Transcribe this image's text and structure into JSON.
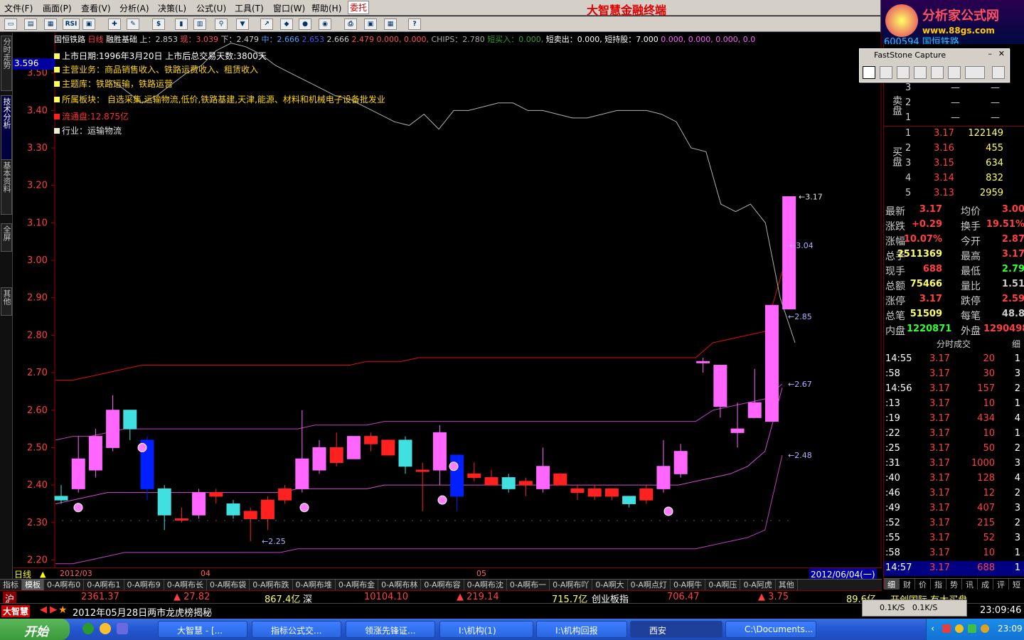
{
  "menu": {
    "items": [
      "文件(F)",
      "画面(P)",
      "查看(V)",
      "分析(A)",
      "决策(L)",
      "公式(U)",
      "工具(T)",
      "窗口(W)",
      "帮助(H)"
    ],
    "hot": "委托",
    "app_title": "大智慧金融终端"
  },
  "brand": {
    "name": "分析家公式网",
    "url": "www.88gs.com"
  },
  "toolbar": {
    "rsi": "RSI"
  },
  "leftnav": {
    "tabs": [
      "分时走势",
      "技术分析",
      "基本资料",
      "全屏",
      "其他"
    ]
  },
  "chart": {
    "name": "国恒铁路",
    "period": "日线",
    "indicator": "融胜基础",
    "info_fields": [
      "上：2.853",
      "现：3.039",
      "下：2.479",
      "中：2.666",
      "2.653",
      "2.666",
      "2.479",
      "0.000, 0.000,",
      "CHIPS：2.780",
      "短买入：0.000,",
      "短卖出：0.000,",
      "短持股：7.000",
      "0.000, 0.000, 0.000, 0.0"
    ],
    "current_price": "3.596",
    "overlay": [
      {
        "text": "上市日期:1996年3月20日  上市后总交易天数:3800天",
        "color": "#ffffff",
        "sq": "#ffff60"
      },
      {
        "text": "主营业务：商品销售收入、铁路运费收入、租赁收入",
        "color": "#ffd700",
        "sq": "#ffff60"
      },
      {
        "text": "主题库：铁路运输，铁路运营",
        "color": "#ffd700",
        "sq": "#ffff60"
      },
      {
        "text": "所属板块： 自选采集,运输物流,低价,铁路基建,天津,能源、材料和机械电子设备批发业",
        "color": "#ffd700",
        "sq": "#ffff60"
      },
      {
        "text": "流通盘:12.875亿",
        "color": "#ff3030",
        "sq": "#ff2020"
      },
      {
        "text": "行业：运输物流",
        "color": "#e0e0e0",
        "sq": "#f0f0d0"
      }
    ],
    "yticks": [
      "3.50",
      "3.40",
      "3.30",
      "3.20",
      "3.10",
      "3.00",
      "2.90",
      "2.80",
      "2.70",
      "2.60",
      "2.50",
      "2.40",
      "2.30",
      "2.20"
    ],
    "annotations": [
      "3.17",
      "3.04",
      "2.85",
      "2.67",
      "2.48",
      "2.25"
    ],
    "dates": [
      "2012/03",
      "04",
      "05"
    ],
    "date_right": "2012/06/04(一)",
    "period_label": "日线"
  },
  "chart_data": {
    "type": "candlestick",
    "ylim": [
      2.18,
      3.6
    ],
    "candles": [
      [
        2.37,
        2.36,
        2.4,
        2.35
      ],
      [
        2.39,
        2.47,
        2.53,
        2.38
      ],
      [
        2.44,
        2.53,
        2.55,
        2.42
      ],
      [
        2.5,
        2.6,
        2.64,
        2.49
      ],
      [
        2.6,
        2.55,
        2.6,
        2.52
      ],
      [
        2.52,
        2.39,
        2.53,
        2.36
      ],
      [
        2.39,
        2.32,
        2.4,
        2.28
      ],
      [
        2.31,
        2.31,
        2.34,
        2.3
      ],
      [
        2.32,
        2.38,
        2.39,
        2.31
      ],
      [
        2.37,
        2.38,
        2.39,
        2.35
      ],
      [
        2.35,
        2.32,
        2.36,
        2.31
      ],
      [
        2.31,
        2.33,
        2.34,
        2.25
      ],
      [
        2.31,
        2.36,
        2.37,
        2.28
      ],
      [
        2.36,
        2.39,
        2.4,
        2.35
      ],
      [
        2.39,
        2.47,
        2.6,
        2.38
      ],
      [
        2.44,
        2.5,
        2.52,
        2.43
      ],
      [
        2.46,
        2.5,
        2.54,
        2.45
      ],
      [
        2.47,
        2.53,
        2.53,
        2.47
      ],
      [
        2.51,
        2.53,
        2.54,
        2.49
      ],
      [
        2.48,
        2.52,
        2.52,
        2.48
      ],
      [
        2.52,
        2.45,
        2.53,
        2.43
      ],
      [
        2.44,
        2.44,
        2.46,
        2.33
      ],
      [
        2.44,
        2.54,
        2.56,
        2.4
      ],
      [
        2.48,
        2.37,
        2.48,
        2.33
      ],
      [
        2.42,
        2.43,
        2.46,
        2.41
      ],
      [
        2.4,
        2.42,
        2.44,
        2.4
      ],
      [
        2.42,
        2.39,
        2.43,
        2.38
      ],
      [
        2.4,
        2.41,
        2.42,
        2.37
      ],
      [
        2.39,
        2.45,
        2.5,
        2.38
      ],
      [
        2.4,
        2.43,
        2.43,
        2.4
      ],
      [
        2.38,
        2.39,
        2.4,
        2.36
      ],
      [
        2.37,
        2.39,
        2.4,
        2.36
      ],
      [
        2.37,
        2.39,
        2.39,
        2.36
      ],
      [
        2.37,
        2.35,
        2.37,
        2.34
      ],
      [
        2.36,
        2.39,
        2.4,
        2.35
      ],
      [
        2.39,
        2.45,
        2.52,
        2.38
      ],
      [
        2.43,
        2.49,
        2.51,
        2.42
      ],
      [
        2.73,
        2.73,
        2.74,
        2.7
      ],
      [
        2.61,
        2.72,
        2.72,
        2.58
      ],
      [
        2.54,
        2.55,
        2.62,
        2.5
      ],
      [
        2.58,
        2.62,
        2.71,
        2.58
      ],
      [
        2.57,
        2.88,
        2.88,
        2.57
      ],
      [
        2.87,
        3.17,
        3.17,
        2.87
      ]
    ],
    "upper": [
      2.68,
      2.68,
      2.69,
      2.7,
      2.71,
      2.72,
      2.72,
      2.72,
      2.72,
      2.72,
      2.72,
      2.72,
      2.72,
      2.72,
      2.72,
      2.72,
      2.72,
      2.72,
      2.73,
      2.73,
      2.73,
      2.74,
      2.74,
      2.74,
      2.74,
      2.74,
      2.74,
      2.74,
      2.74,
      2.74,
      2.74,
      2.74,
      2.74,
      2.74,
      2.74,
      2.74,
      2.74,
      2.74,
      2.78,
      2.79,
      2.8,
      2.81,
      2.97
    ],
    "mid": [
      2.52,
      2.53,
      2.53,
      2.54,
      2.55,
      2.55,
      2.55,
      2.55,
      2.55,
      2.55,
      2.55,
      2.55,
      2.55,
      2.55,
      2.55,
      2.56,
      2.56,
      2.56,
      2.56,
      2.57,
      2.57,
      2.57,
      2.57,
      2.57,
      2.57,
      2.57,
      2.57,
      2.57,
      2.57,
      2.57,
      2.57,
      2.57,
      2.57,
      2.57,
      2.57,
      2.57,
      2.57,
      2.57,
      2.6,
      2.61,
      2.62,
      2.63,
      2.67
    ],
    "lower": [
      2.35,
      2.36,
      2.37,
      2.38,
      2.38,
      2.38,
      2.38,
      2.38,
      2.38,
      2.38,
      2.38,
      2.38,
      2.38,
      2.38,
      2.39,
      2.39,
      2.39,
      2.39,
      2.39,
      2.4,
      2.4,
      2.4,
      2.4,
      2.4,
      2.4,
      2.4,
      2.4,
      2.4,
      2.4,
      2.4,
      2.4,
      2.4,
      2.4,
      2.4,
      2.4,
      2.4,
      2.4,
      2.41,
      2.42,
      2.43,
      2.45,
      2.49,
      2.66
    ],
    "bottom": [
      2.19,
      2.19,
      2.2,
      2.21,
      2.22,
      2.22,
      2.22,
      2.22,
      2.22,
      2.22,
      2.22,
      2.22,
      2.22,
      2.22,
      2.23,
      2.23,
      2.23,
      2.23,
      2.23,
      2.23,
      2.23,
      2.23,
      2.23,
      2.23,
      2.23,
      2.23,
      2.23,
      2.23,
      2.23,
      2.23,
      2.23,
      2.23,
      2.23,
      2.23,
      2.23,
      2.23,
      2.23,
      2.23,
      2.24,
      2.25,
      2.26,
      2.28,
      2.48
    ],
    "ma": [
      3.48,
      3.45,
      3.42,
      3.44,
      3.47,
      3.5,
      3.52,
      3.56,
      3.58,
      3.57,
      3.55,
      3.52,
      3.5,
      3.48,
      3.46,
      3.44,
      3.43,
      3.41,
      3.39,
      3.37,
      3.36,
      3.39,
      3.35,
      3.4,
      3.4,
      3.41,
      3.42,
      3.42,
      3.4,
      3.4,
      3.39,
      3.38,
      3.38,
      3.39,
      3.4,
      3.4,
      3.4,
      3.39,
      3.37,
      3.3,
      3.29,
      3.15,
      3.13,
      3.15,
      3.1,
      2.9,
      2.78
    ]
  },
  "bottom_tabs": [
    "指标",
    "模板",
    "0-A啊布0",
    "0-A啊布1",
    "0-A啊布9",
    "0-A啊布长",
    "0-A啊布袋",
    "0-A啊布跌",
    "0-A啊布堆",
    "0-A啊布金",
    "0-A啊布林",
    "0-A啊布容",
    "0-A啊布沈",
    "0-A啊布一",
    "0-A啊布吖",
    "0-A啊大",
    "0-A啊点灯",
    "0-A啊牛",
    "0-A啊压",
    "0-A阿虎",
    "其他"
  ],
  "indexbar": {
    "sh": "沪",
    "sh_val": "2361.37",
    "sh_chg": "▲ 27.82",
    "sh_amt": "867.4亿",
    "sz": "深",
    "sz_val": "10104.10",
    "sz_chg": "▲ 219.14",
    "sz_amt": "715.7亿",
    "cy": "创业板指",
    "cy_val": "706.47",
    "cy_chg": "▲ 3.75",
    "right": "89.6亿"
  },
  "news": {
    "logo": "大智慧",
    "text": "2012年05月28日两市龙虎榜揭秘",
    "right_tag": "开创国际 有大买盘",
    "net1": "0.1K/S",
    "net2": "0.1K/S",
    "clock": "23:09:46"
  },
  "rightpanel": {
    "code": "600594 国恒铁路",
    "sell": [
      [
        "3",
        "—",
        "—"
      ],
      [
        "2",
        "—",
        "—"
      ],
      [
        "1",
        "—",
        "—"
      ]
    ],
    "sell_label": "卖盘",
    "buy_label": "买盘",
    "buy": [
      [
        "1",
        "3.17",
        "122149"
      ],
      [
        "2",
        "3.16",
        "455"
      ],
      [
        "3",
        "3.15",
        "634"
      ],
      [
        "4",
        "3.14",
        "832"
      ],
      [
        "5",
        "3.13",
        "2959"
      ]
    ],
    "quote": [
      [
        "最新",
        "3.17",
        "均价",
        "3.00"
      ],
      [
        "涨跌",
        "+0.29",
        "换手",
        "19.51%"
      ],
      [
        "涨幅",
        "10.07%",
        "今开",
        "2.87"
      ],
      [
        "总手",
        "2511369",
        "最高",
        "3.17"
      ],
      [
        "现手",
        "688",
        "最低",
        "2.79"
      ],
      [
        "总额",
        "75466",
        "量比",
        "1.51"
      ],
      [
        "涨停",
        "3.17",
        "跌停",
        "2.59"
      ],
      [
        "总笔",
        "51509",
        "每笔",
        "48.8"
      ]
    ],
    "inner": "内盘",
    "inner_v": "1220871",
    "outer": "外盘",
    "outer_v": "1290498",
    "ticks_title": "分时成交",
    "ticks_tag": "细",
    "ticks": [
      [
        "14:55",
        "3.17",
        "20",
        "1"
      ],
      [
        ":58",
        "3.17",
        "30",
        "3"
      ],
      [
        "14:56",
        "3.17",
        "157",
        "2"
      ],
      [
        ":13",
        "3.17",
        "10",
        "1"
      ],
      [
        ":19",
        "3.17",
        "434",
        "4"
      ],
      [
        ":22",
        "3.17",
        "10",
        "1"
      ],
      [
        ":25",
        "3.17",
        "50",
        "2"
      ],
      [
        ":31",
        "3.17",
        "1000",
        "3"
      ],
      [
        ":40",
        "3.17",
        "128",
        "4"
      ],
      [
        ":46",
        "3.17",
        "12",
        "2"
      ],
      [
        ":49",
        "3.17",
        "407",
        "3"
      ],
      [
        ":52",
        "3.17",
        "215",
        "2"
      ],
      [
        ":55",
        "3.17",
        "52",
        "3"
      ],
      [
        ":58",
        "3.17",
        "10",
        "1"
      ],
      [
        "14:57",
        "3.17",
        "688",
        "1"
      ]
    ],
    "bottom_tabs": [
      "细",
      "财",
      "价",
      "指",
      "势",
      "讯",
      "成",
      "评",
      "短"
    ]
  },
  "faststone": {
    "title": "FastStone Capture"
  },
  "taskbar": {
    "start": "开始",
    "tasks": [
      "大智慧 - [...",
      "指标公式交...",
      "领涨先锋证...",
      "I:\\机构(1)",
      "I:\\机构回报",
      "西安",
      "C:\\Documents..."
    ],
    "time": "23:09"
  }
}
